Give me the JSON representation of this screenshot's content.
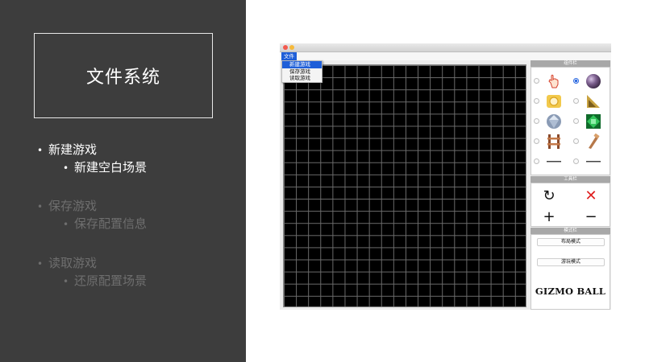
{
  "left": {
    "title": "文件系统",
    "bullets": [
      {
        "label": "新建游戏",
        "sub": "新建空白场景",
        "state": "active"
      },
      {
        "label": "保存游戏",
        "sub": "保存配置信息",
        "state": "dim"
      },
      {
        "label": "读取游戏",
        "sub": "还原配置场景",
        "state": "dim"
      }
    ]
  },
  "window": {
    "menu_label": "文件",
    "dropdown": [
      "新建游戏",
      "保存游戏",
      "读取游戏"
    ],
    "grid": {
      "rows": 20,
      "cols": 20
    },
    "components_panel_title": "组件栏",
    "components": [
      {
        "icon": "hand-pointer-icon",
        "selected": false
      },
      {
        "icon": "purple-ball-icon",
        "selected": true
      },
      {
        "icon": "gold-circle-block-icon",
        "selected": false
      },
      {
        "icon": "gold-triangle-block-icon",
        "selected": false
      },
      {
        "icon": "diamond-icon",
        "selected": false
      },
      {
        "icon": "green-gem-icon",
        "selected": false
      },
      {
        "icon": "track-icon",
        "selected": false
      },
      {
        "icon": "wooden-pipe-icon",
        "selected": false
      },
      {
        "icon": "left-flipper-icon",
        "selected": false
      },
      {
        "icon": "right-flipper-icon",
        "selected": false
      }
    ],
    "tools_panel_title": "工具栏",
    "tools": [
      {
        "icon": "rotate-icon",
        "glyph": "↻"
      },
      {
        "icon": "delete-icon",
        "glyph": "✕"
      },
      {
        "icon": "zoom-in-icon",
        "glyph": "+"
      },
      {
        "icon": "zoom-out-icon",
        "glyph": "−"
      }
    ],
    "mode_panel_title": "模式栏",
    "layout_mode": "布局模式",
    "play_mode": "游玩模式",
    "logo": "GIZMO BALL",
    "colors": {
      "accent": "#1f5fd8",
      "panel_dark": "#3d3d3d",
      "delete": "#e02020"
    }
  }
}
